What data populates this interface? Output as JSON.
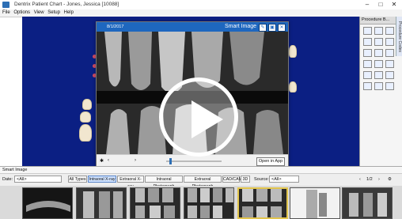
{
  "window": {
    "title": "Dentrix Patient Chart - Jones, Jessica [10088]",
    "controls": [
      "–",
      "□",
      "✕"
    ]
  },
  "menu": {
    "items": [
      "File",
      "Options",
      "View",
      "Setup",
      "Help"
    ]
  },
  "procedure_panel": {
    "title": "Procedure B..."
  },
  "side_tab": "Procedure Codes",
  "smart_image": {
    "date": "8/1/2017",
    "title": "Smart Image",
    "open_app": "Open in App"
  },
  "bottom": {
    "panel_title": "Smart Image",
    "date_label": "Date:",
    "date_value": "<All>",
    "tabs": [
      "All Types",
      "Intraoral X-ray",
      "Extraoral X-ray",
      "Intraoral Photograph",
      "Extraoral Photograph",
      "CAD/CAM",
      "3D"
    ],
    "source_label": "Source:",
    "source_value": "<All>",
    "page": "1/2"
  },
  "colors": {
    "chart_bg": "#0b1f83",
    "header_blue": "#1e67bf",
    "selection": "#e2c54d"
  }
}
